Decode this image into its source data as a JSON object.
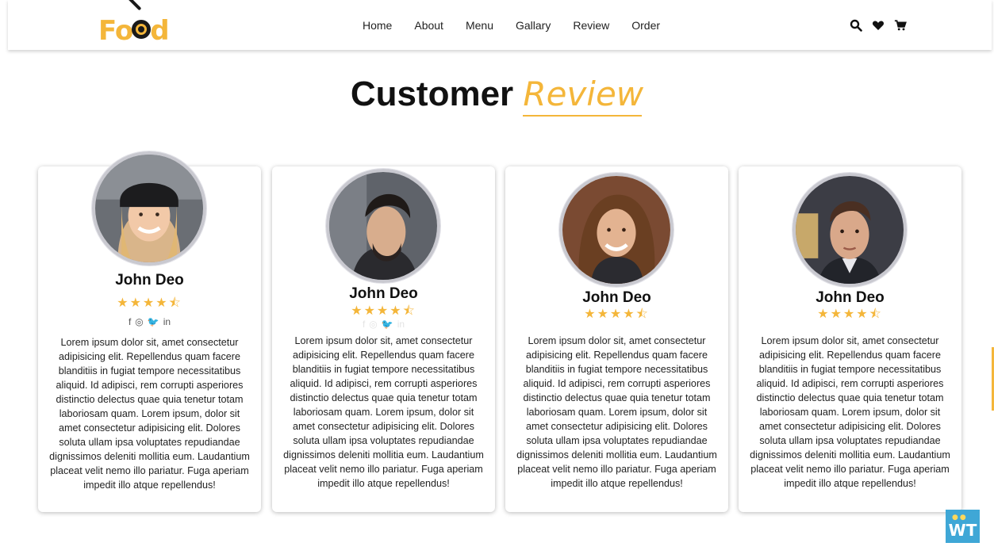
{
  "header": {
    "logo": {
      "before": "Fo",
      "after": "d"
    },
    "nav": [
      "Home",
      "About",
      "Menu",
      "Gallary",
      "Review",
      "Order"
    ],
    "icons": [
      "search-icon",
      "heart-icon",
      "cart-icon"
    ]
  },
  "section": {
    "title": "Customer",
    "title_accent": "Review"
  },
  "colors": {
    "accent": "#f4b63a",
    "text": "#111111",
    "card_border": "#c9c9d0"
  },
  "reviews": [
    {
      "name": "John Deo",
      "rating": 4.5,
      "stars": "★★★★⯪",
      "social": [
        "f",
        "◎",
        "🐦",
        "in"
      ],
      "text": "Lorem ipsum dolor sit, amet consectetur adipisicing elit. Repellendus quam facere blanditiis in fugiat tempore necessitatibus aliquid. Id adipisci, rem corrupti asperiores distinctio delectus quae quia tenetur totam laboriosam quam. Lorem ipsum, dolor sit amet consectetur adipisicing elit. Dolores soluta ullam ipsa voluptates repudiandae dignissimos deleniti mollitia eum. Laudantium placeat velit nemo illo pariatur. Fuga aperiam impedit illo atque repellendus!"
    },
    {
      "name": "John Deo",
      "rating": 4.5,
      "stars": "★★★★⯪",
      "social": [
        "f",
        "◎",
        "🐦",
        "in"
      ],
      "text": "Lorem ipsum dolor sit, amet consectetur adipisicing elit. Repellendus quam facere blanditiis in fugiat tempore necessitatibus aliquid. Id adipisci, rem corrupti asperiores distinctio delectus quae quia tenetur totam laboriosam quam. Lorem ipsum, dolor sit amet consectetur adipisicing elit. Dolores soluta ullam ipsa voluptates repudiandae dignissimos deleniti mollitia eum. Laudantium placeat velit nemo illo pariatur. Fuga aperiam impedit illo atque repellendus!"
    },
    {
      "name": "John Deo",
      "rating": 4.5,
      "stars": "★★★★⯪",
      "text": "Lorem ipsum dolor sit, amet consectetur adipisicing elit. Repellendus quam facere blanditiis in fugiat tempore necessitatibus aliquid. Id adipisci, rem corrupti asperiores distinctio delectus quae quia tenetur totam laboriosam quam. Lorem ipsum, dolor sit amet consectetur adipisicing elit. Dolores soluta ullam ipsa voluptates repudiandae dignissimos deleniti mollitia eum. Laudantium placeat velit nemo illo pariatur. Fuga aperiam impedit illo atque repellendus!"
    },
    {
      "name": "John Deo",
      "rating": 4.5,
      "stars": "★★★★⯪",
      "text": "Lorem ipsum dolor sit, amet consectetur adipisicing elit. Repellendus quam facere blanditiis in fugiat tempore necessitatibus aliquid. Id adipisci, rem corrupti asperiores distinctio delectus quae quia tenetur totam laboriosam quam. Lorem ipsum, dolor sit amet consectetur adipisicing elit. Dolores soluta ullam ipsa voluptates repudiandae dignissimos deleniti mollitia eum. Laudantium placeat velit nemo illo pariatur. Fuga aperiam impedit illo atque repellendus!"
    }
  ],
  "badge": {
    "label": "WT"
  }
}
